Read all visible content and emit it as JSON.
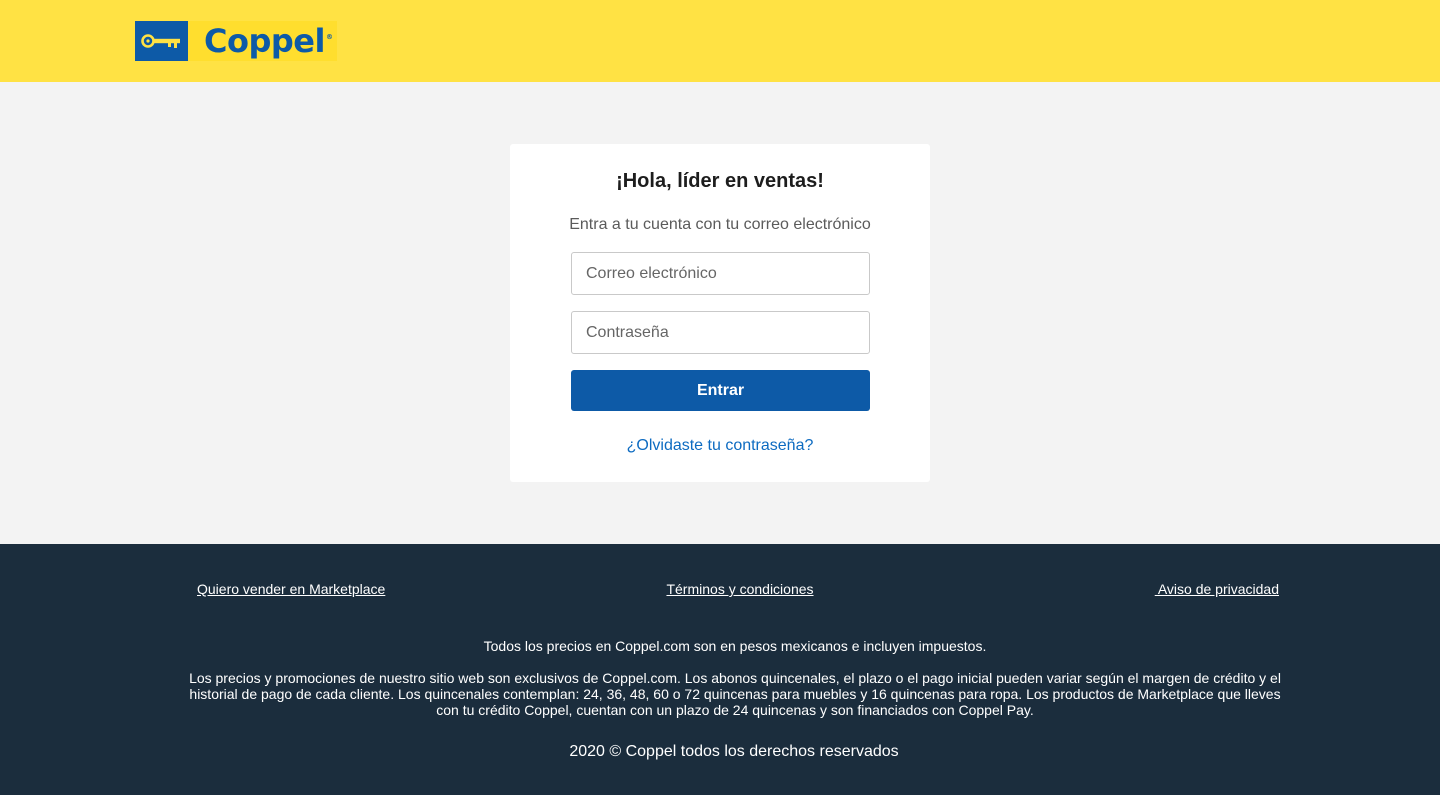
{
  "header": {
    "logo_text": "Coppel",
    "logo_mark": "key-icon",
    "brand_colors": {
      "yellow": "#ffe244",
      "blue": "#0d5aa7"
    }
  },
  "login": {
    "title": "¡Hola, líder en ventas!",
    "subtitle": "Entra a tu cuenta con tu correo electrónico",
    "email_placeholder": "Correo electrónico",
    "email_value": "",
    "password_placeholder": "Contraseña",
    "password_value": "",
    "submit_label": "Entrar",
    "forgot_label": "¿Olvidaste tu contraseña?"
  },
  "footer": {
    "links": [
      {
        "label": "Quiero vender en Marketplace"
      },
      {
        "label": "Términos y condiciones"
      },
      {
        "label": " Aviso de privacidad"
      }
    ],
    "prices_note": "Todos los precios en Coppel.com son en pesos mexicanos e incluyen impuestos.",
    "legal_paragraph": "Los precios y promociones de nuestro sitio web son exclusivos de Coppel.com. Los abonos quincenales, el plazo o el pago inicial pueden variar según el margen de crédito y el historial de pago de cada cliente. Los quincenales contemplan: 24, 36, 48, 60 o 72 quincenas para muebles y 16 quincenas para ropa. Los productos de Marketplace que lleves con tu crédito Coppel, cuentan con un plazo de 24 quincenas y son financiados con Coppel Pay.",
    "copyright": "2020 © Coppel todos los derechos reservados",
    "background": "#1b2d3d"
  }
}
